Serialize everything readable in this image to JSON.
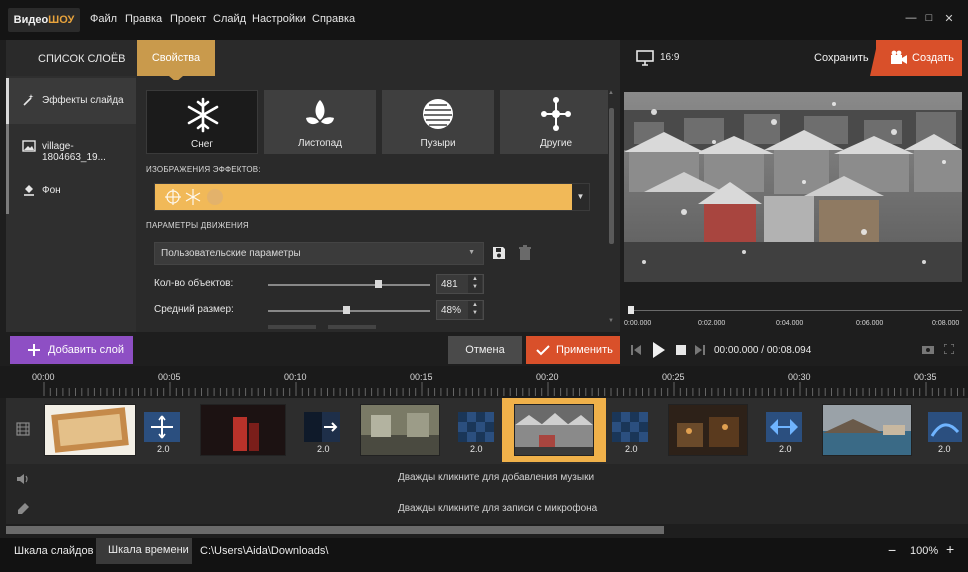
{
  "app": {
    "logo_part1": "Видео",
    "logo_part2": "ШОУ"
  },
  "menu": [
    "Файл",
    "Правка",
    "Проект",
    "Слайд",
    "Настройки",
    "Справка"
  ],
  "window_controls": [
    "—",
    "□",
    "✕"
  ],
  "left_panel": {
    "layers_tab": "СПИСОК СЛОЁВ",
    "properties_tab": "Свойства",
    "layers": [
      {
        "label": "Эффекты слайда",
        "icon": "magic-wand-icon"
      },
      {
        "label": "village-1804663_19...",
        "icon": "image-icon"
      },
      {
        "label": "Фон",
        "icon": "paint-bucket-icon"
      }
    ],
    "add_layer": "Добавить слой"
  },
  "properties": {
    "effects": [
      {
        "label": "Снег",
        "icon": "snowflake-icon",
        "selected": true
      },
      {
        "label": "Листопад",
        "icon": "leaves-icon",
        "selected": false
      },
      {
        "label": "Пузыри",
        "icon": "bubble-icon",
        "selected": false
      },
      {
        "label": "Другие",
        "icon": "molecule-icon",
        "selected": false
      }
    ],
    "images_section": "ИЗОБРАЖЕНИЯ ЭФФЕКТОВ:",
    "motion_section": "ПАРАМЕТРЫ ДВИЖЕНИЯ",
    "preset": "Пользовательские параметры",
    "params": [
      {
        "label": "Кол-во объектов:",
        "value": "481",
        "level": 0.68
      },
      {
        "label": "Средний размер:",
        "value": "48%",
        "level": 0.48
      }
    ],
    "cancel": "Отмена",
    "apply": "Применить"
  },
  "preview": {
    "ratio": "16:9",
    "save": "Сохранить",
    "create": "Создать",
    "ticks": [
      "0:00.000",
      "0:02.000",
      "0:04.000",
      "0:06.000",
      "0:08.000"
    ],
    "timecode": "00:00.000 / 00:08.094"
  },
  "timeline": {
    "ruler": [
      "00:00",
      "00:05",
      "00:10",
      "00:15",
      "00:20",
      "00:25",
      "00:30",
      "00:35"
    ],
    "durations": [
      "2.0",
      "2.0",
      "2.0",
      "2.0",
      "2.0",
      "2.0"
    ],
    "music_hint": "Дважды кликните для добавления музыки",
    "mic_hint": "Дважды кликните для записи с микрофона"
  },
  "status": {
    "tab_slides": "Шкала слайдов",
    "tab_time": "Шкала времени",
    "path": "C:\\Users\\Aida\\Downloads\\",
    "zoom": "100%"
  },
  "colors": {
    "accent_orange": "#d9502a",
    "accent_gold": "#c99a4c",
    "purple": "#8e4fc4",
    "effect_bar": "#f1b958"
  }
}
